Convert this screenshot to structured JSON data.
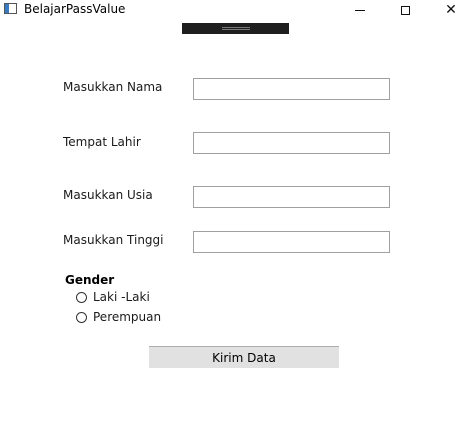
{
  "window": {
    "title": "BelajarPassValue",
    "minimize_icon": "minimize-icon",
    "maximize_icon": "maximize-icon",
    "close_icon": "close-icon",
    "close_glyph": "✕"
  },
  "form": {
    "fields": [
      {
        "label": "Masukkan Nama",
        "value": ""
      },
      {
        "label": "Tempat Lahir",
        "value": ""
      },
      {
        "label": "Masukkan Usia",
        "value": ""
      },
      {
        "label": "Masukkan Tinggi",
        "value": ""
      }
    ],
    "gender": {
      "title": "Gender",
      "options": [
        {
          "label": "Laki -Laki",
          "selected": false
        },
        {
          "label": "Perempuan",
          "selected": false
        }
      ]
    },
    "submit_label": "Kirim Data"
  },
  "colors": {
    "button_bg": "#e1e1e1",
    "input_border": "#a0a0a0",
    "devbar_bg": "#1e1e1e"
  }
}
